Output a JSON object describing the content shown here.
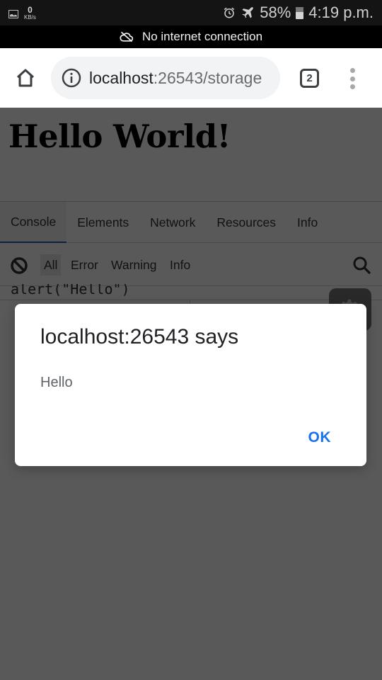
{
  "status_bar": {
    "net_speed_value": "0",
    "net_speed_unit": "KB/s",
    "battery": "58%",
    "battery_level_percent": 58,
    "time": "4:19 p.m.",
    "icons": [
      "image-icon",
      "alarm-icon",
      "airplane-mode-icon",
      "battery-icon"
    ]
  },
  "offline_banner": {
    "text": "No internet connection",
    "icon": "cloud-off-icon"
  },
  "browser": {
    "url_host": "localhost",
    "url_rest": ":26543/storage",
    "tab_count": "2",
    "icons": [
      "home-icon",
      "info-icon",
      "tab-switcher-icon",
      "more-vert-icon"
    ]
  },
  "page": {
    "heading": "Hello World!"
  },
  "devtools": {
    "tabs": [
      {
        "label": "Console",
        "active": true
      },
      {
        "label": "Elements",
        "active": false
      },
      {
        "label": "Network",
        "active": false
      },
      {
        "label": "Resources",
        "active": false
      },
      {
        "label": "Info",
        "active": false
      }
    ],
    "filters": [
      {
        "label": "All",
        "active": true
      },
      {
        "label": "Error",
        "active": false
      },
      {
        "label": "Warning",
        "active": false
      },
      {
        "label": "Info",
        "active": false
      }
    ],
    "console_line": "alert(\"Hello\")",
    "accent_color": "#2a56c6"
  },
  "dialog": {
    "title": "localhost:26543 says",
    "message": "Hello",
    "ok_label": "OK",
    "ok_color": "#1a73e8"
  }
}
